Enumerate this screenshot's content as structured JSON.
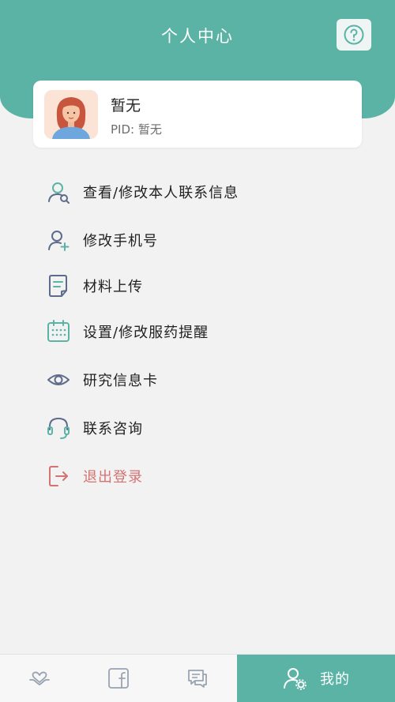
{
  "header": {
    "title": "个人中心",
    "help_icon": "question-circle-icon",
    "background_color": "#5bb3a6"
  },
  "profile": {
    "name": "暂无",
    "pid_label": "PID: 暂无",
    "avatar_icon": "user-avatar-illustration"
  },
  "menu": {
    "items": [
      {
        "label": "查看/修改本人联系信息",
        "icon": "user-search-icon"
      },
      {
        "label": "修改手机号",
        "icon": "user-add-icon"
      },
      {
        "label": "材料上传",
        "icon": "document-icon"
      },
      {
        "label": "设置/修改服药提醒",
        "icon": "calendar-icon"
      },
      {
        "label": "研究信息卡",
        "icon": "eye-icon"
      },
      {
        "label": "联系咨询",
        "icon": "headset-icon"
      },
      {
        "label": "退出登录",
        "icon": "logout-icon"
      }
    ]
  },
  "bottom_nav": {
    "tabs": [
      {
        "icon": "heart-hands-icon"
      },
      {
        "icon": "facebook-icon"
      },
      {
        "icon": "chat-icon"
      },
      {
        "label": "我的",
        "icon": "user-settings-icon"
      }
    ],
    "active_color": "#5bb3a6"
  }
}
